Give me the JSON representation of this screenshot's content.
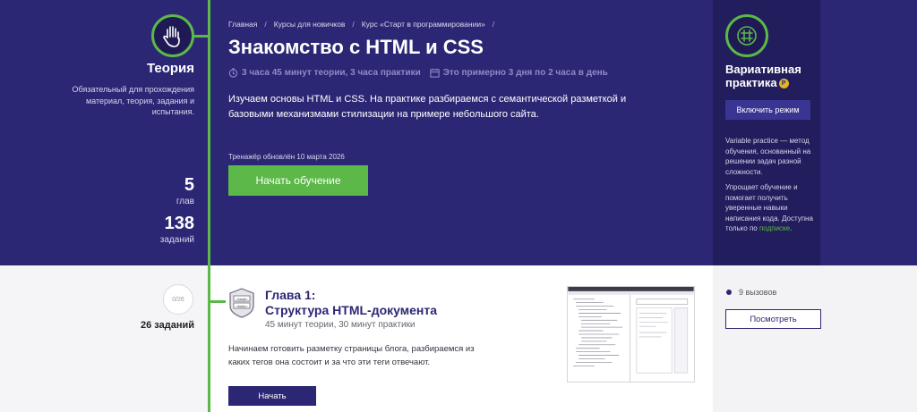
{
  "theory": {
    "title": "Теория",
    "description": "Обязательный для прохождения материал, теория, задания и испытания.",
    "chapters_value": "5",
    "chapters_label": "глав",
    "tasks_value": "138",
    "tasks_label": "заданий"
  },
  "breadcrumb": [
    "Главная",
    "Курсы для новичков",
    "Курс «Старт в программировании»"
  ],
  "breadcrumb_separator": "/",
  "course": {
    "title": "Знакомство с HTML и CSS",
    "duration": "3 часа 45 минут теории, 3 часа практики",
    "schedule": "Это примерно 3 дня по 2 часа в день",
    "intro": "Изучаем основы HTML и CSS. На практике разбираемся с семантической разметкой и базовыми механизмами стилизации на примере небольшого сайта.",
    "updated": "Тренажёр обновлён 10 марта 2026",
    "start_label": "Начать обучение"
  },
  "variable_practice": {
    "title": "Вариативная практика",
    "coin": "Р",
    "enable_label": "Включить режим",
    "text1": "Variable practice — метод обучения, основанный на решении задач разной сложности.",
    "text2_prefix": "Упрощает обучение и помогает получить уверенные навыки написания кода. Доступна только по",
    "text2_link": "подписке",
    "text2_suffix": "."
  },
  "chapter": {
    "progress": "0/26",
    "tasks": "26 заданий",
    "number_label": "Глава 1:",
    "title": "Структура HTML-документа",
    "time": "45 минут теории, 30 минут практики",
    "description": "Начинаем готовить разметку страницы блога, разбираемся из каких тегов она состоит и за что эти теги отвечают.",
    "start_label": "Начать",
    "calls": "9 вызовов",
    "view_label": "Посмотреть",
    "icon_lines": [
      "<head>",
      "<body>"
    ]
  },
  "colors": {
    "hero": "#2c2774",
    "side_panel": "#221d5c",
    "accent_green": "#5cb848",
    "coin": "#e6b422"
  },
  "icons": {
    "theory": "hand-icon",
    "variable_practice": "target-icon",
    "clock": "clock-icon",
    "calendar": "calendar-icon",
    "chapter": "html-badge-icon"
  }
}
